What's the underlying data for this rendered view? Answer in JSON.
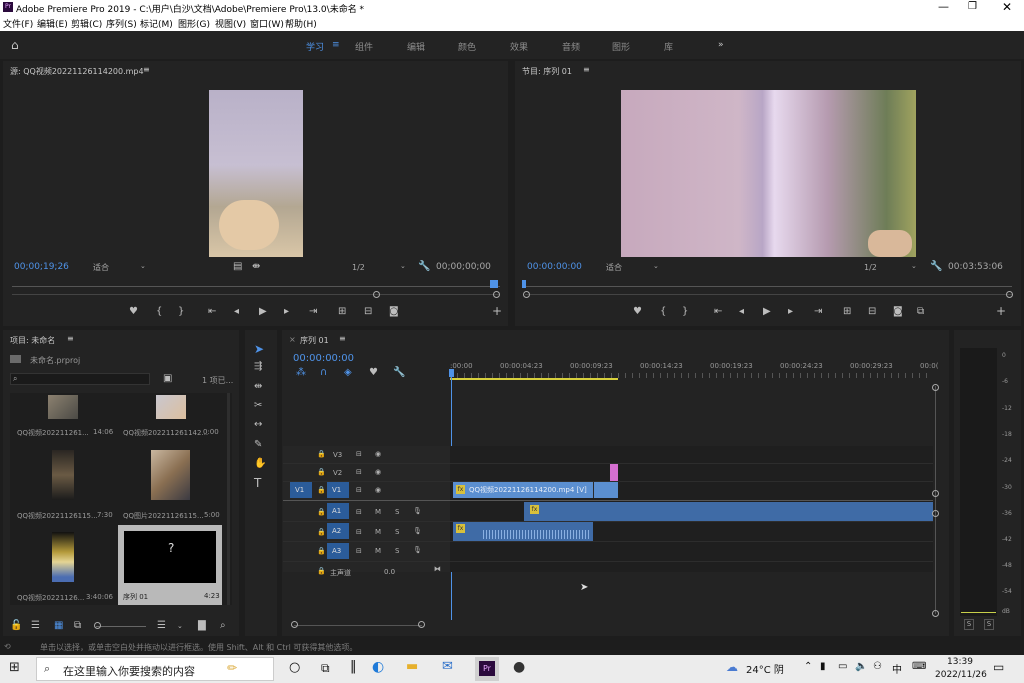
{
  "titlebar": {
    "title": "Adobe Premiere Pro 2019 - C:\\用户\\白沙\\文档\\Adobe\\Premiere Pro\\13.0\\未命名 *",
    "app_icon": "premiere-icon"
  },
  "menu": [
    "文件(F)",
    "编辑(E)",
    "剪辑(C)",
    "序列(S)",
    "标记(M)",
    "图形(G)",
    "视图(V)",
    "窗口(W)",
    "帮助(H)"
  ],
  "workspace": {
    "tabs": [
      "学习",
      "组件",
      "编辑",
      "颜色",
      "效果",
      "音频",
      "图形",
      "库"
    ],
    "active": "学习",
    "more": "»"
  },
  "source": {
    "title": "源: QQ视频20221126114200.mp4",
    "timecode_left": "00;00;19;26",
    "fit": "适合",
    "resolution": "1/2",
    "timecode_right": "00;00;00;00"
  },
  "program": {
    "title": "节目: 序列 01",
    "timecode_left": "00:00:00:00",
    "fit": "适合",
    "resolution": "1/2",
    "timecode_right": "00:03:53:06"
  },
  "project": {
    "title": "项目: 未命名",
    "file": "未命名.prproj",
    "search_placeholder": "",
    "count": "1 项已...",
    "items": [
      {
        "name": "QQ视频202211261...",
        "dur": "14:06"
      },
      {
        "name": "QQ视频202211261142...",
        "dur": "0:00"
      },
      {
        "name": "QQ视频20221126115...",
        "dur": "7:30"
      },
      {
        "name": "QQ图片20221126115...",
        "dur": "5:00"
      },
      {
        "name": "QQ视频20221126...",
        "dur": "3:40:06"
      },
      {
        "name": "序列 01",
        "dur": "4:23"
      }
    ]
  },
  "timeline": {
    "title": "序列 01",
    "timecode": "00:00:00:00",
    "ruler": [
      ":00:00",
      "00:00:04:23",
      "00:00:09:23",
      "00:00:14:23",
      "00:00:19:23",
      "00:00:24:23",
      "00:00:29:23",
      "00:0("
    ],
    "tracks": {
      "v3": "V3",
      "v2": "V2",
      "v1": "V1",
      "src_v1": "V1",
      "a1": "A1",
      "a2": "A2",
      "a3": "A3",
      "m": "M",
      "s": "S",
      "master": "主声道",
      "master_val": "0.0"
    },
    "clip_v1": "QQ视频20221126114200.mp4 [V]",
    "fx": "fx"
  },
  "meter": {
    "labels": [
      "0",
      "-6",
      "-12",
      "-18",
      "-24",
      "-30",
      "-36",
      "-42",
      "-48",
      "-54",
      "dB"
    ],
    "s1": "S",
    "s2": "S"
  },
  "status": "单击以选择，或单击空白处并拖动以进行框选。使用 Shift、Alt 和 Ctrl 可获得其他选项。",
  "taskbar": {
    "search_placeholder": "在这里输入你要搜索的内容",
    "weather": "24°C 阴",
    "ime": "中",
    "time": "13:39",
    "date": "2022/11/26"
  },
  "colors": {
    "accent": "#4f93e8",
    "panel": "#232323",
    "clip_video": "#5b8fd0",
    "clip_audio": "#3f6ba6",
    "pink": "#d56fd0",
    "yellow": "#d7d03c"
  }
}
